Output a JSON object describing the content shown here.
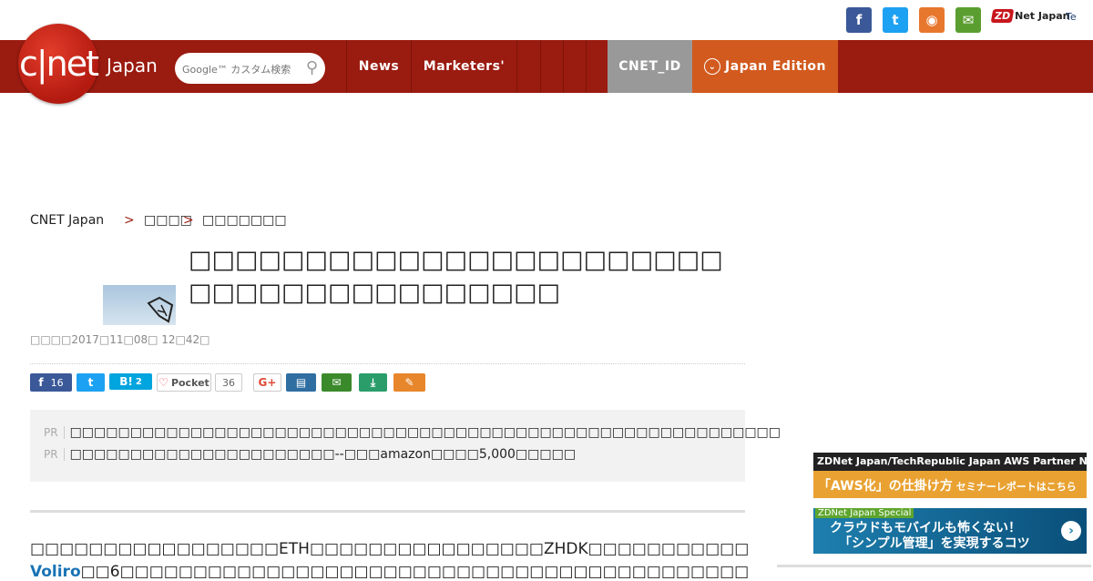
{
  "colors": {
    "brand_red": "#9a1b10",
    "cnet_id_bg": "#999999",
    "japan_edition_bg": "#d25a1e",
    "link_blue": "#1a73b5"
  },
  "top_social": [
    {
      "name": "facebook-icon",
      "glyph": "f"
    },
    {
      "name": "twitter-icon",
      "glyph": "t"
    },
    {
      "name": "rss-icon",
      "glyph": "◉"
    },
    {
      "name": "mail-icon",
      "glyph": "✉"
    }
  ],
  "partners": {
    "zdnet": "Net Japan",
    "zdnet_mark": "ZD",
    "techrepublic": "Te"
  },
  "logo": {
    "mark": "c|net",
    "edition": "Japan"
  },
  "search": {
    "placeholder": "Google™ カスタム検索",
    "icon": "⚲"
  },
  "nav": {
    "news": "News",
    "marketers": "Marketers'",
    "cnet_id": "CNET_ID",
    "japan_edition": "Japan Edition",
    "japan_edition_icon": "⌄"
  },
  "breadcrumb": {
    "home": "CNET Japan",
    "sep": ">",
    "item2": "□□□□",
    "item3": "□□□□□□□"
  },
  "article": {
    "title": "□□□□□□□□□□□□□□□□□□□□□□□□□□□□□□□□□□□□□□□",
    "date": "□□□□2017□11□08□ 12□42□",
    "body_line1": "□□□□□□□□□□□□□□□□□ETH□□□□□□□□□□□□□□□□ZHDK□□□□□□□□□□□□□□□□□□□□□□□□□□□",
    "body_link": "Voliro",
    "body_line2": "□□6□□□□□□□□□□□□□□□□□□□□□□□□□□□□□□□□□□□□□□□□□□□□□□□□□□□□□□□"
  },
  "share": {
    "facebook_count": "16",
    "hatena_label": "B!",
    "hatena_count": "2",
    "pocket_label": "Pocket",
    "pocket_count": "36",
    "gplus_label": "G+"
  },
  "pr": {
    "tag": "PR",
    "items": [
      "□□□□□□□□□□□□□□□□□□□□□□□□□□□□□□□□□□□□□□□□□□□□□□□□□□□□□□□□□□□",
      "□□□□□□□□□□□□□□□□□□□□□□--□□□amazon□□□□5,000□□□□□"
    ]
  },
  "ads": {
    "ad1_header": "ZDNet Japan/TechRepublic Japan  AWS Partner Network",
    "ad1_main": "「AWS化」の仕掛け方",
    "ad1_sub": "セミナーレポートはこちら",
    "ad2_tag": "ZDNet Japan Special",
    "ad2_line1": "クラウドもモバイルも怖くない！",
    "ad2_line2": "「シンプル管理」を実現するコツ",
    "ad2_arrow": "›"
  }
}
